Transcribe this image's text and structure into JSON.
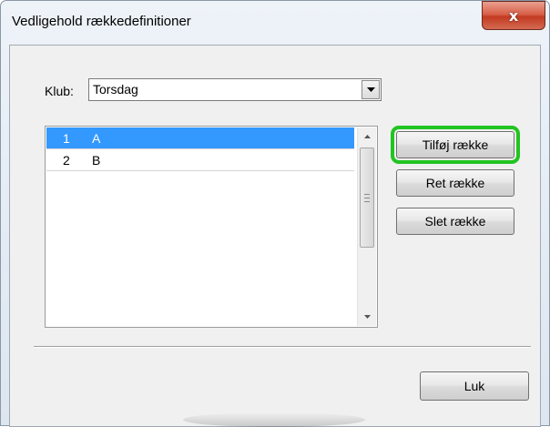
{
  "window": {
    "title": "Vedligehold rækkedefinitioner",
    "close_label": "x"
  },
  "club": {
    "label": "Klub:",
    "selected": "Torsdag"
  },
  "list": {
    "items": [
      {
        "number": "1",
        "name": "A",
        "selected": true
      },
      {
        "number": "2",
        "name": "B",
        "selected": false
      }
    ]
  },
  "actions": {
    "add_label": "Tilføj række",
    "edit_label": "Ret række",
    "delete_label": "Slet række"
  },
  "footer": {
    "close_label": "Luk"
  },
  "colors": {
    "selection": "#3399ff",
    "highlight": "#22c422",
    "close_button": "#c23b22"
  }
}
